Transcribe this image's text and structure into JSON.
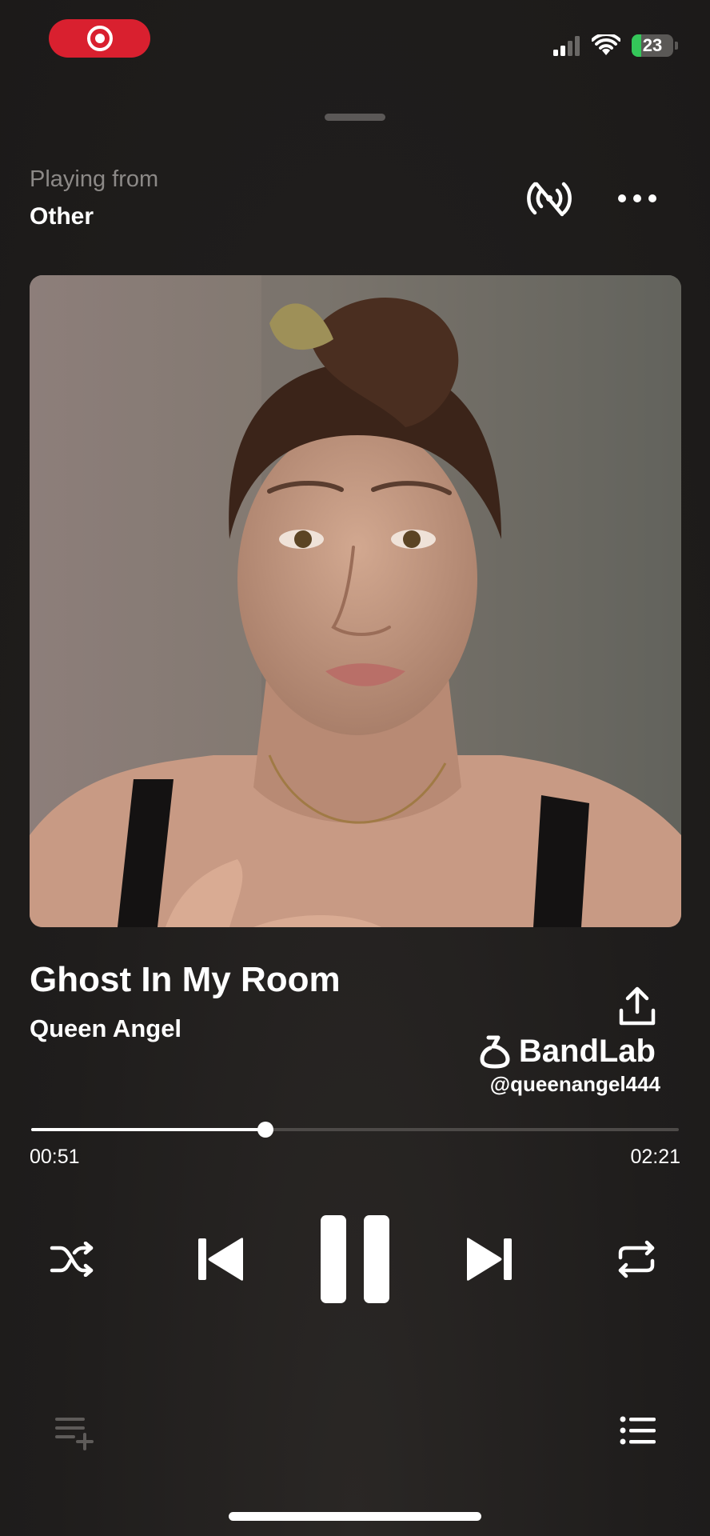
{
  "status_bar": {
    "battery_level": "23",
    "battery_fraction": 0.23,
    "recording": true
  },
  "header": {
    "playing_from_label": "Playing from",
    "playing_from_value": "Other"
  },
  "track": {
    "title": "Ghost In My Room",
    "artist": "Queen Angel"
  },
  "watermark": {
    "brand": "BandLab",
    "handle": "@queenangel444"
  },
  "playback": {
    "elapsed": "00:51",
    "duration": "02:21",
    "progress_fraction": 0.3617,
    "state": "playing"
  },
  "icons": {
    "record": "record-icon",
    "signal": "cellular-signal-icon",
    "wifi": "wifi-icon",
    "battery": "battery-charging-icon",
    "broadcast": "broadcast-off-icon",
    "more": "more-horizontal-icon",
    "share": "share-icon",
    "shuffle": "shuffle-icon",
    "previous": "skip-previous-icon",
    "pause": "pause-icon",
    "next": "skip-next-icon",
    "repeat": "repeat-icon",
    "add_to_queue": "add-to-queue-icon",
    "queue": "queue-list-icon"
  },
  "colors": {
    "background": "#201e1d",
    "record_pill": "#d9202f",
    "battery_fill": "#34c759",
    "secondary_text": "#8c8987"
  }
}
